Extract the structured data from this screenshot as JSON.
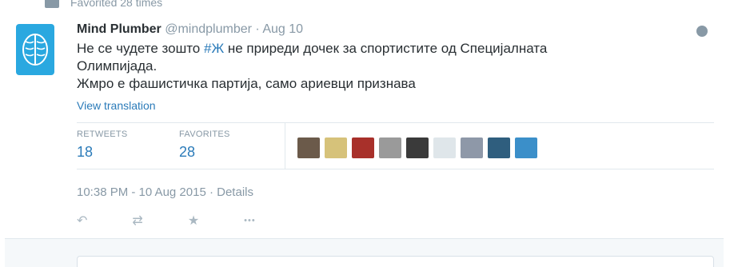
{
  "context": {
    "text": "Favorited 28 times"
  },
  "tweet": {
    "fullname": "Mind Plumber",
    "username": "@mindplumber",
    "separator": "·",
    "time_ago": "Aug 10",
    "line1_pre": "Не се чудете зошто ",
    "hashtag": "#Ж",
    "line1_post": " не приреди дочек за спортистите од Специјалната",
    "line2": "Олимпијада.",
    "line3": "Жмро е фашистичка партија, само ариевци признава",
    "view_translation": "View translation"
  },
  "stats": {
    "retweets_label": "RETWEETS",
    "retweets_value": "18",
    "favorites_label": "FAVORITES",
    "favorites_value": "28"
  },
  "favoriters": [
    {
      "name": "favoriter-1",
      "color": "#6b5a4a"
    },
    {
      "name": "favoriter-2",
      "color": "#d6c27a"
    },
    {
      "name": "favoriter-3",
      "color": "#a8302a"
    },
    {
      "name": "favoriter-4",
      "color": "#9a9a9a"
    },
    {
      "name": "favoriter-5",
      "color": "#3a3a3a"
    },
    {
      "name": "favoriter-6",
      "color": "#dfe6ea"
    },
    {
      "name": "favoriter-7",
      "color": "#8e98a8"
    },
    {
      "name": "favoriter-8",
      "color": "#2f5e7e"
    },
    {
      "name": "favoriter-9",
      "color": "#3b8fc9"
    }
  ],
  "timestamp": "10:38 PM - 10 Aug 2015",
  "details": "· Details",
  "actions": {
    "reply_icon": "reply-icon",
    "retweet_icon": "retweet-icon",
    "favorite_icon": "star-icon",
    "more_label": "•••"
  },
  "colors": {
    "accent": "#2b7bb9",
    "muted": "#8899a6",
    "avatar": "#2aa8e0"
  }
}
